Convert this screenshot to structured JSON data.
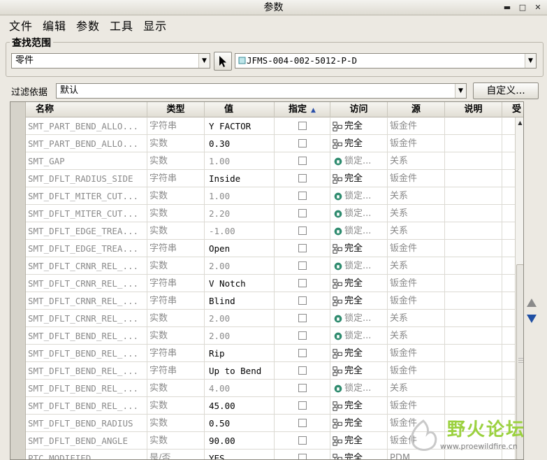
{
  "window": {
    "title": "参数"
  },
  "menu": [
    "文件",
    "编辑",
    "参数",
    "工具",
    "显示"
  ],
  "search_group": {
    "legend": "查找范围",
    "scope_value": "零件",
    "model_value": "JFMS-004-002-5012-P-D"
  },
  "filter": {
    "label": "过滤依据",
    "value": "默认",
    "customize_label": "自定义..."
  },
  "columns": [
    "名称",
    "类型",
    "值",
    "指定",
    "访问",
    "源",
    "说明",
    "受"
  ],
  "rows": [
    {
      "name": "SMT_PART_BEND_ALLO...",
      "type": "字符串",
      "value": "Y FACTOR",
      "access": "完全",
      "source": "钣金件",
      "locked": false
    },
    {
      "name": "SMT_PART_BEND_ALLO...",
      "type": "实数",
      "value": "0.30",
      "access": "完全",
      "source": "钣金件",
      "locked": false
    },
    {
      "name": "SMT_GAP",
      "type": "实数",
      "value": "1.00",
      "access": "锁定...",
      "source": "关系",
      "locked": true
    },
    {
      "name": "SMT_DFLT_RADIUS_SIDE",
      "type": "字符串",
      "value": "Inside",
      "access": "完全",
      "source": "钣金件",
      "locked": false
    },
    {
      "name": "SMT_DFLT_MITER_CUT...",
      "type": "实数",
      "value": "1.00",
      "access": "锁定...",
      "source": "关系",
      "locked": true
    },
    {
      "name": "SMT_DFLT_MITER_CUT...",
      "type": "实数",
      "value": "2.20",
      "access": "锁定...",
      "source": "关系",
      "locked": true
    },
    {
      "name": "SMT_DFLT_EDGE_TREA...",
      "type": "实数",
      "value": "-1.00",
      "access": "锁定...",
      "source": "关系",
      "locked": true
    },
    {
      "name": "SMT_DFLT_EDGE_TREA...",
      "type": "字符串",
      "value": "Open",
      "access": "完全",
      "source": "钣金件",
      "locked": false
    },
    {
      "name": "SMT_DFLT_CRNR_REL_...",
      "type": "实数",
      "value": "2.00",
      "access": "锁定...",
      "source": "关系",
      "locked": true
    },
    {
      "name": "SMT_DFLT_CRNR_REL_...",
      "type": "字符串",
      "value": "V Notch",
      "access": "完全",
      "source": "钣金件",
      "locked": false
    },
    {
      "name": "SMT_DFLT_CRNR_REL_...",
      "type": "字符串",
      "value": "Blind",
      "access": "完全",
      "source": "钣金件",
      "locked": false
    },
    {
      "name": "SMT_DFLT_CRNR_REL_...",
      "type": "实数",
      "value": "2.00",
      "access": "锁定...",
      "source": "关系",
      "locked": true
    },
    {
      "name": "SMT_DFLT_BEND_REL_...",
      "type": "实数",
      "value": "2.00",
      "access": "锁定...",
      "source": "关系",
      "locked": true
    },
    {
      "name": "SMT_DFLT_BEND_REL_...",
      "type": "字符串",
      "value": "Rip",
      "access": "完全",
      "source": "钣金件",
      "locked": false
    },
    {
      "name": "SMT_DFLT_BEND_REL_...",
      "type": "字符串",
      "value": "Up to Bend",
      "access": "完全",
      "source": "钣金件",
      "locked": false
    },
    {
      "name": "SMT_DFLT_BEND_REL_...",
      "type": "实数",
      "value": "4.00",
      "access": "锁定...",
      "source": "关系",
      "locked": true
    },
    {
      "name": "SMT_DFLT_BEND_REL_...",
      "type": "实数",
      "value": "45.00",
      "access": "完全",
      "source": "钣金件",
      "locked": false
    },
    {
      "name": "SMT_DFLT_BEND_RADIUS",
      "type": "实数",
      "value": "0.50",
      "access": "完全",
      "source": "钣金件",
      "locked": false
    },
    {
      "name": "SMT_DFLT_BEND_ANGLE",
      "type": "实数",
      "value": "90.00",
      "access": "完全",
      "source": "钣金件",
      "locked": false
    },
    {
      "name": "PTC_MODIFIED",
      "type": "是/否",
      "value": "YES",
      "access": "完全",
      "source": "PDM",
      "locked": false
    }
  ],
  "watermark": {
    "title": "野火论坛",
    "url": "www.proewildfire.cn"
  },
  "colors": {
    "lock_icon": "#2e8b6e",
    "nav_arrow_up": "#8a8a8a",
    "nav_arrow_down": "#1f4fa3",
    "watermark": "#9bd13f"
  },
  "icons": {
    "lock": "lock-icon",
    "full_access": "full-access-icon",
    "pointer": "select-pointer-icon",
    "part": "part-icon"
  }
}
